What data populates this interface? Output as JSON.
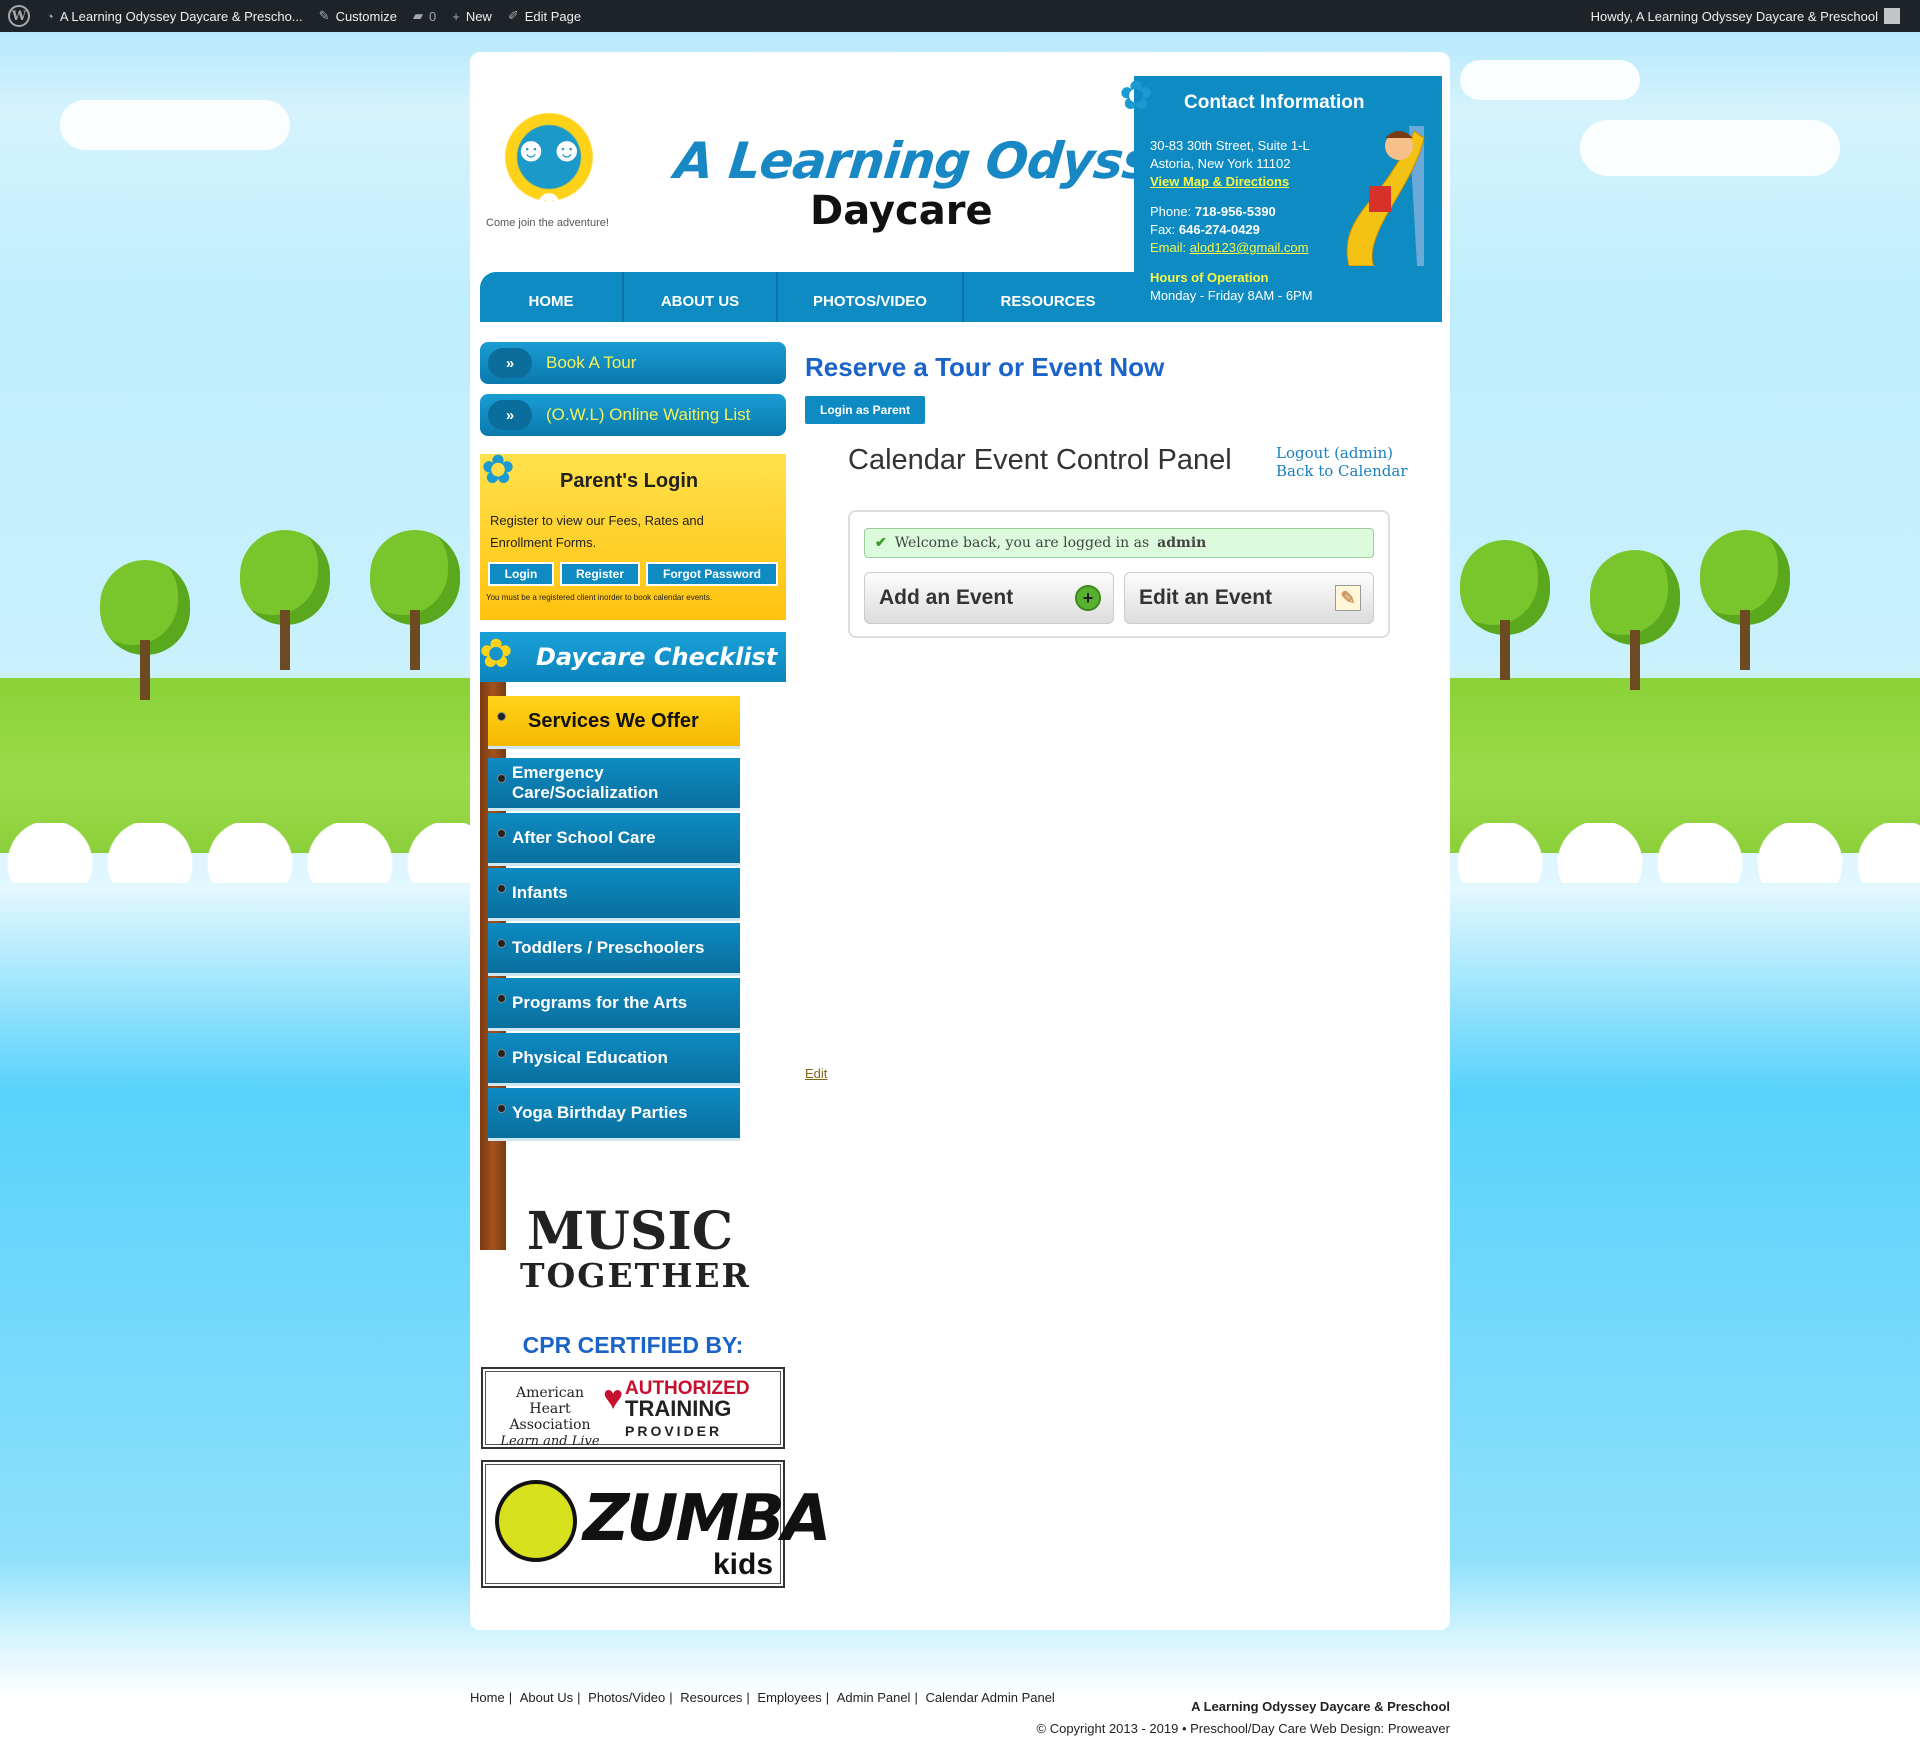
{
  "admin_bar": {
    "site_name": "A Learning Odyssey Daycare & Prescho...",
    "customize": "Customize",
    "comments_count": "0",
    "new": "New",
    "edit_page": "Edit Page",
    "howdy": "Howdy, A Learning Odyssey Daycare & Preschool"
  },
  "header": {
    "tagline": "Come join the adventure!",
    "brand_line1": "A Learning Odyssey",
    "brand_line2": "Daycare"
  },
  "contact": {
    "title": "Contact Information",
    "address1": "30-83 30th Street, Suite 1-L",
    "address2": "Astoria, New York 11102",
    "map_link": "View Map & Directions",
    "phone_label": "Phone:",
    "phone": "718-956-5390",
    "fax_label": "Fax:",
    "fax": "646-274-0429",
    "email_label": "Email:",
    "email": "alod123@gmail.com",
    "hours_title": "Hours of Operation",
    "hours": "Monday - Friday 8AM - 6PM"
  },
  "nav": [
    "HOME",
    "ABOUT US",
    "PHOTOS/VIDEO",
    "RESOURCES"
  ],
  "sidebar": {
    "book_tour": "Book A Tour",
    "owl": "(O.W.L) Online Waiting List",
    "parent_login": {
      "title": "Parent's Login",
      "text": "Register to view our Fees, Rates and Enrollment Forms.",
      "login": "Login",
      "register": "Register",
      "forgot": "Forgot Password",
      "note": "You must be a registered client inorder to book calendar events."
    },
    "checklist_title": "Daycare Checklist",
    "services_header": "Services We Offer",
    "services": [
      "Emergency Care/Socialization",
      "After School Care",
      "Infants",
      "Toddlers / Preschoolers",
      "Programs for the Arts",
      "Physical Education",
      "Yoga Birthday Parties"
    ],
    "music_line1": "MUSIC",
    "music_line2": "TOGETHER",
    "cpr_title": "CPR CERTIFIED BY:",
    "aha_line1": "American Heart Association",
    "aha_line2": "Learn and Live",
    "aha_auth1": "AUTHORIZED",
    "aha_auth2": "TRAINING",
    "aha_auth3": "PROVIDER",
    "zumba": "ZUMBA",
    "zumba_kids": "kids"
  },
  "main": {
    "heading": "Reserve a Tour or Event Now",
    "login_parent": "Login as Parent",
    "panel_title": "Calendar Event Control Panel",
    "logout": "Logout (admin)",
    "back": "Back to Calendar",
    "welcome": "Welcome back, you are logged in as",
    "welcome_user": "admin",
    "add_event": "Add an Event",
    "edit_event": "Edit an Event",
    "edit_link": "Edit"
  },
  "footer": {
    "links": [
      "Home",
      "About Us",
      "Photos/Video",
      "Resources",
      "Employees",
      "Admin Panel",
      "Calendar Admin Panel"
    ],
    "company": "A Learning Odyssey Daycare & Preschool",
    "copyright": "© Copyright 2013 - 2019 • Preschool/Day Care Web Design: Proweaver"
  },
  "colors": {
    "primary_blue": "#0d8bc2",
    "yellow": "#ffc20e",
    "heading_blue": "#1a63c8"
  }
}
